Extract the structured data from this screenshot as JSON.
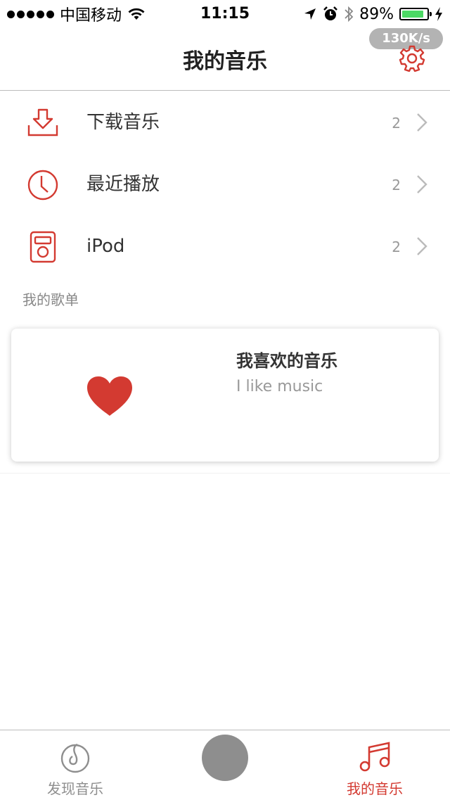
{
  "statusbar": {
    "carrier": "中国移动",
    "time": "11:15",
    "battery_pct": "89%",
    "battery_level": 0.89,
    "icons": [
      "signal-dots",
      "wifi-icon",
      "location-icon",
      "alarm-icon",
      "bluetooth-icon",
      "battery-icon",
      "charging-icon"
    ]
  },
  "speed_badge": "130K/s",
  "nav": {
    "title": "我的音乐",
    "settings_icon": "gear-icon"
  },
  "menu": [
    {
      "label": "下载音乐",
      "count": "2",
      "icon": "download-icon"
    },
    {
      "label": "最近播放",
      "count": "2",
      "icon": "clock-icon"
    },
    {
      "label": "iPod",
      "count": "2",
      "icon": "ipod-icon"
    }
  ],
  "section": {
    "title": "我的歌单"
  },
  "playlist": {
    "title": "我喜欢的音乐",
    "subtitle": "I like music",
    "icon": "heart-icon"
  },
  "tabs": [
    {
      "label": "发现音乐",
      "icon": "netease-logo-icon",
      "active": false
    },
    {
      "label": "",
      "icon": "play-button",
      "active": false
    },
    {
      "label": "我的音乐",
      "icon": "music-note-icon",
      "active": true
    }
  ],
  "colors": {
    "accent": "#d33a31",
    "inactive": "#8e8e8e",
    "battery": "#4cd964"
  }
}
